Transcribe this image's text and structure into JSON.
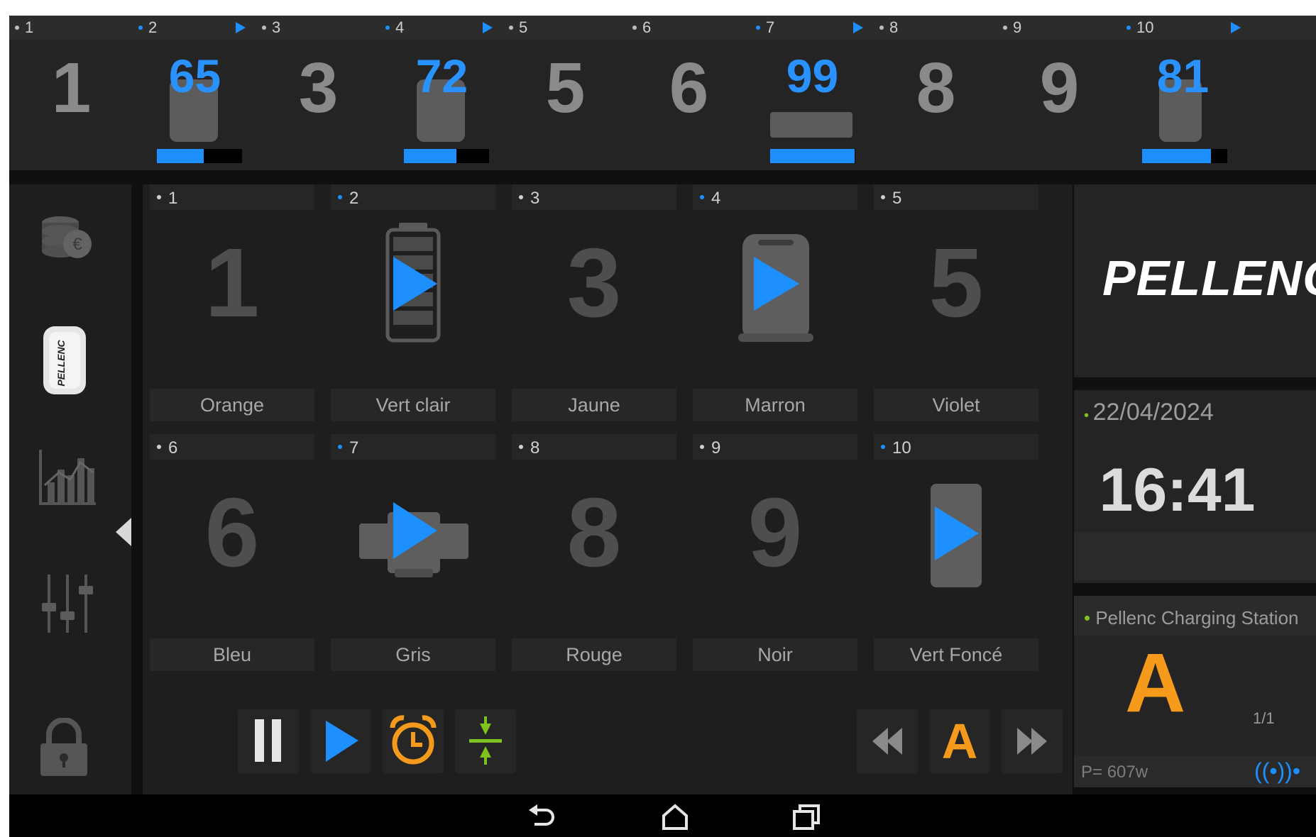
{
  "top_slots": [
    {
      "num": "• 1",
      "big": "1",
      "percent": null,
      "active": false
    },
    {
      "num": "• 2",
      "big": "",
      "percent": "65",
      "active": true,
      "level": 0.55
    },
    {
      "num": "• 3",
      "big": "3",
      "percent": null,
      "active": false
    },
    {
      "num": "• 4",
      "big": "",
      "percent": "72",
      "active": true,
      "level": 0.62
    },
    {
      "num": "• 5",
      "big": "5",
      "percent": null,
      "active": false
    },
    {
      "num": "• 6",
      "big": "6",
      "percent": null,
      "active": false
    },
    {
      "num": "• 7",
      "big": "",
      "percent": "99",
      "active": true,
      "level": 0.99
    },
    {
      "num": "• 8",
      "big": "8",
      "percent": null,
      "active": false
    },
    {
      "num": "• 9",
      "big": "9",
      "percent": null,
      "active": false
    },
    {
      "num": "• 10",
      "big": "",
      "percent": "81",
      "active": true,
      "level": 0.81
    }
  ],
  "slots": [
    {
      "num": "1",
      "big": "1",
      "label": "Orange"
    },
    {
      "num": "2",
      "big": "",
      "label": "Vert clair",
      "icon": "battery-charging-icon"
    },
    {
      "num": "3",
      "big": "3",
      "label": "Jaune"
    },
    {
      "num": "4",
      "big": "",
      "label": "Marron",
      "icon": "backpack-battery-charging-icon"
    },
    {
      "num": "5",
      "big": "5",
      "label": "Violet"
    },
    {
      "num": "6",
      "big": "6",
      "label": "Bleu"
    },
    {
      "num": "7",
      "big": "",
      "label": "Gris",
      "icon": "t-battery-charging-icon"
    },
    {
      "num": "8",
      "big": "8",
      "label": "Rouge"
    },
    {
      "num": "9",
      "big": "9",
      "label": "Noir"
    },
    {
      "num": "10",
      "big": "",
      "label": "Vert Foncé",
      "icon": "slim-battery-charging-icon"
    }
  ],
  "sidebar": [
    "coins-euro-icon",
    "battery-pellenc-icon",
    "statistics-chart-icon",
    "sliders-settings-icon",
    "lock-icon"
  ],
  "battery_label": "PELLENC",
  "controls": {
    "mode_letter": "A"
  },
  "logo": "PELLENC",
  "date": "22/04/2024",
  "time": "16:41",
  "station": {
    "name": "Pellenc Charging Station",
    "letter": "A",
    "page": "1/1",
    "power": "P= 607w",
    "wifi": "((•))•"
  },
  "colors": {
    "accent": "#1e8fff",
    "orange": "#f59a1a",
    "green": "#7dc21e",
    "background": "#101010"
  }
}
